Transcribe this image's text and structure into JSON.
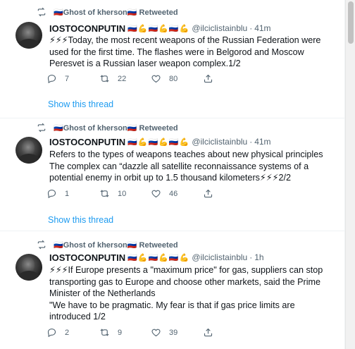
{
  "tweets": [
    {
      "retweeted_by": "Ghost of kherson",
      "retweet_label": "Retweeted",
      "author_name": "IOSTOCONPUTIN",
      "handle": "@ilciclistainblu",
      "time": "41m",
      "lines": [
        "⚡⚡⚡Today, the most recent weapons of the Russian Federation were used for the first time. The flashes were in Belgorod and Moscow",
        "Peresvet is a Russian laser weapon complex.1/2"
      ],
      "replies": "7",
      "retweets": "22",
      "likes": "80",
      "show_thread": "Show this thread"
    },
    {
      "retweeted_by": "Ghost of kherson",
      "retweet_label": "Retweeted",
      "author_name": "IOSTOCONPUTIN",
      "handle": "@ilciclistainblu",
      "time": "41m",
      "lines": [
        "Refers to the types of weapons teaches about new physical principles",
        "The complex can “dazzle all satellite reconnaissance systems of a potential enemy in orbit up to 1.5 thousand kilometers⚡⚡⚡2/2"
      ],
      "replies": "1",
      "retweets": "10",
      "likes": "46",
      "show_thread": "Show this thread"
    },
    {
      "retweeted_by": "Ghost of kherson",
      "retweet_label": "Retweeted",
      "author_name": "IOSTOCONPUTIN",
      "handle": "@ilciclistainblu",
      "time": "1h",
      "lines": [
        "⚡⚡⚡If Europe presents a \"maximum price\" for gas, suppliers can stop transporting gas to Europe and choose other markets, said the Prime Minister of the Netherlands",
        "\"We have to be pragmatic. My fear is that if gas price limits are introduced 1/2"
      ],
      "replies": "2",
      "retweets": "9",
      "likes": "39"
    }
  ],
  "icons": {
    "flag": "🇷🇺",
    "flex": "💪",
    "retweet": "retweet-icon",
    "reply": "reply-icon",
    "like": "heart-icon",
    "share": "share-icon"
  },
  "colors": {
    "link": "#1d9bf0",
    "muted": "#536471",
    "text": "#0f1419"
  }
}
